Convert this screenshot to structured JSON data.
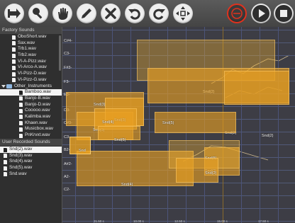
{
  "colors": {
    "accent": "#e9a022",
    "record": "#e0321e",
    "grid_bg": "#3d3d45",
    "panel_bg": "#2f2f2f"
  },
  "toolbar": {
    "icons": [
      "import-icon",
      "effects-icon",
      "hand-icon",
      "pencil-icon",
      "delete-icon",
      "undo-icon",
      "redo-icon",
      "move-icon",
      "record-icon",
      "play-icon",
      "stop-icon"
    ]
  },
  "sidebar": {
    "factory_title": "Factory Sounds",
    "factory_items": [
      "OboShort.wav",
      "Sax.wav",
      "Trb1.wav",
      "Trb2.wav",
      "VI-A-Pizz.wav",
      "VI-Arco-A.wav",
      "VI-Pizz-D.wav",
      "VI-Pizz-G.wav"
    ],
    "folder_name": "Other_Instruments",
    "folder_items": [
      "Bamboo.wav",
      "Banjo-B.wav",
      "Banjo-D.wav",
      "Cooooo.wav",
      "Kalimba.wav",
      "Khaen.wav",
      "Musicbox.wav",
      "PnKrvxt.wav"
    ],
    "selected_factory_item": "Bamboo.wav",
    "user_title": "User Recorded Sounds",
    "user_items": [
      "Snd(2).wav",
      "Snd(3).wav",
      "Snd(4).wav",
      "Snd(5).wav",
      "Snd.wav"
    ],
    "selected_user_item": "Snd(2).wav"
  },
  "grid": {
    "note_labels": [
      "C#4-",
      "C3-",
      "F#3-",
      "F3-",
      "E3-",
      "D3-",
      "C#3-",
      "C3-",
      "B2-",
      "A#2-",
      "A2-",
      "C2-"
    ],
    "time_labels": [
      "21.50 s",
      "10.00 s",
      "12.50 s",
      "15.00 s",
      "17.50 s"
    ],
    "clips": [
      {
        "label": "Snd(2)"
      },
      {
        "label": "Snd(2)"
      },
      {
        "label": "Snd(2)"
      },
      {
        "label": "Snd(2)"
      },
      {
        "label": "Snd(3)"
      },
      {
        "label": "Snd(3)"
      },
      {
        "label": "Snd(3)"
      },
      {
        "label": "Snd(4)"
      },
      {
        "label": "Snd(4)"
      },
      {
        "label": "Snd(5)"
      },
      {
        "label": "Snd(5)"
      },
      {
        "label": "Snd(5)"
      },
      {
        "label": "Snd"
      },
      {
        "label": "Snd(2)"
      }
    ]
  }
}
